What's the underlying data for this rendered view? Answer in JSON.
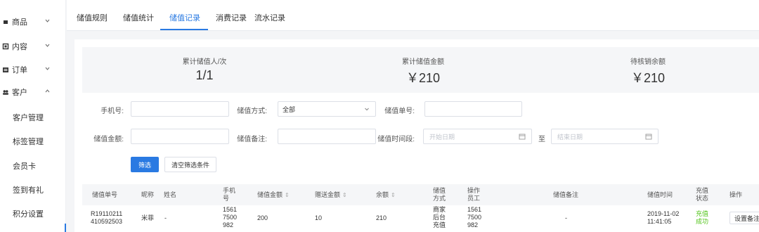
{
  "sidebar": {
    "groups": [
      {
        "label": "商品",
        "icon": "goods-icon"
      },
      {
        "label": "内容",
        "icon": "content-icon"
      },
      {
        "label": "订单",
        "icon": "order-icon"
      },
      {
        "label": "客户",
        "icon": "customer-icon"
      }
    ],
    "sub_items": [
      "客户管理",
      "标签管理",
      "会员卡",
      "签到有礼",
      "积分设置"
    ]
  },
  "tabs": [
    "储值规则",
    "储值统计",
    "储值记录",
    "消费记录",
    "流水记录"
  ],
  "active_tab": "储值记录",
  "stats": [
    {
      "label": "累计储值人/次",
      "value": "1/1"
    },
    {
      "label": "累计储值金额",
      "value": "￥210"
    },
    {
      "label": "待核销余额",
      "value": "￥210"
    }
  ],
  "filters": {
    "phone_label": "手机号:",
    "method_label": "储值方式:",
    "method_value": "全部",
    "order_no_label": "储值单号:",
    "amount_label": "储值金额:",
    "remark_label": "储值备注:",
    "time_label": "储值时间段:",
    "start_placeholder": "开始日期",
    "to_label": "至",
    "end_placeholder": "结束日期",
    "filter_button": "筛选",
    "clear_button": "清空筛选条件"
  },
  "table": {
    "headers": {
      "order_no": "储值单号",
      "nickname": "昵称",
      "name": "姓名",
      "phone": [
        "手机",
        "号"
      ],
      "amount": "储值金额",
      "gift": "赠送金额",
      "balance": "余额",
      "method": [
        "储值",
        "方式"
      ],
      "operator": [
        "操作",
        "员工"
      ],
      "remark": "储值备注",
      "time": "储值时间",
      "status": [
        "充值",
        "状态"
      ],
      "action": "操作"
    },
    "rows": [
      {
        "order_no": [
          "R19110211",
          "410592503"
        ],
        "nickname": "米菲",
        "name": "-",
        "phone": [
          "1561",
          "7500",
          "982"
        ],
        "amount": "200",
        "gift": "10",
        "balance": "210",
        "method": [
          "商家",
          "后台",
          "充值"
        ],
        "operator": [
          "1561",
          "7500",
          "982"
        ],
        "remark": "-",
        "time": [
          "2019-11-02",
          "11:41:05"
        ],
        "status": [
          "充值",
          "成功"
        ],
        "action": "设置备注"
      }
    ]
  },
  "colors": {
    "accent": "#2a7ae2",
    "success": "#52c41a",
    "stat_bg": "#f5f6f8"
  }
}
